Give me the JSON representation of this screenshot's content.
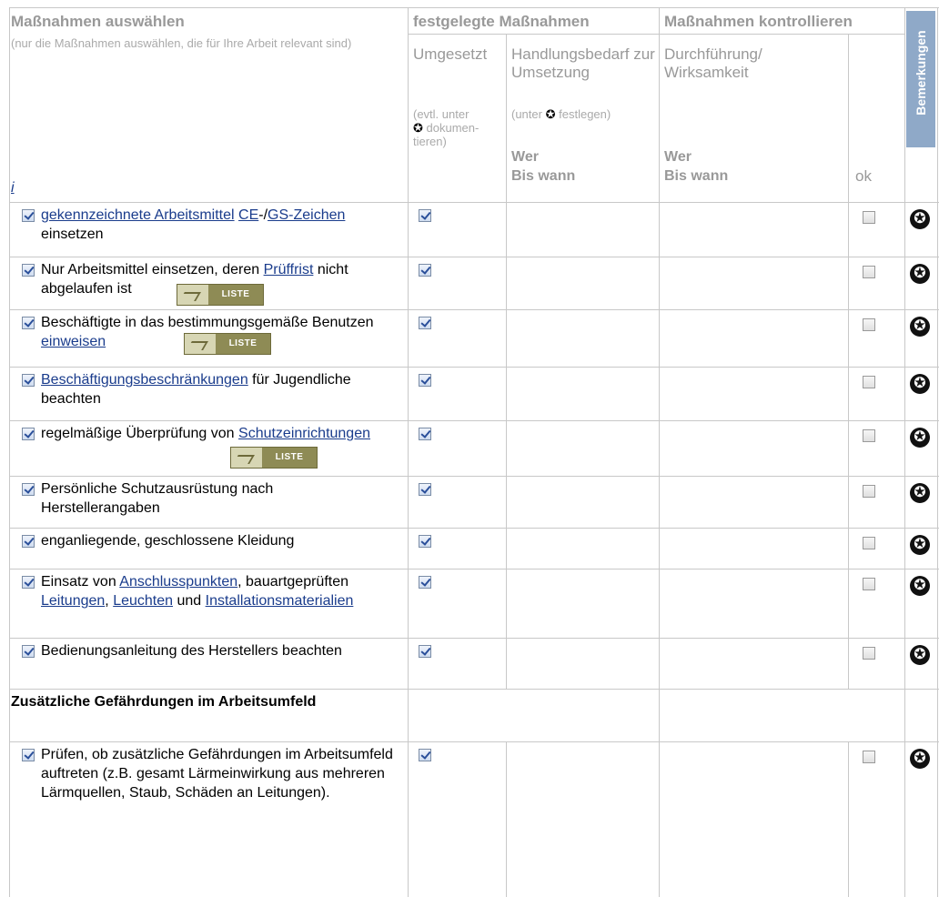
{
  "header": {
    "measures_title": "Maßnahmen auswählen",
    "measures_note": "(nur die Maßnahmen auswählen, die für Ihre Arbeit relevant sind)",
    "info_link": "i",
    "fixed_title": "festgelegte Maßnahmen",
    "implemented": "Umgesetzt",
    "implemented_note_1": "(evtl. unter",
    "implemented_note_2": "dokumen-",
    "implemented_note_3": "tieren)",
    "need": "Handlungsbedarf zur Umsetzung",
    "need_note_1": "(unter",
    "need_note_2": "festlegen)",
    "wer1": "Wer",
    "bis1": "Bis wann",
    "control_title": "Maßnahmen kontrollieren",
    "exec": "Durchführung/ Wirksamkeit",
    "wer2": "Wer",
    "bis2": "Bis wann",
    "ok": "ok",
    "remarks": "Bemerkungen"
  },
  "liste_label": "LISTE",
  "star_glyph": "✪",
  "rows": [
    {
      "parts": [
        {
          "t": "gekennzeichnete Arbeitsmittel",
          "link": true
        },
        {
          "t": " "
        },
        {
          "t": "CE",
          "link": true
        },
        {
          "t": "-/"
        },
        {
          "t": "GS-Zeichen",
          "link": true
        },
        {
          "t": " einsetzen"
        }
      ],
      "implemented": true,
      "ok": false
    },
    {
      "parts": [
        {
          "t": "Nur Arbeitsmittel einsetzen, deren "
        },
        {
          "t": "Prüffrist",
          "link": true
        },
        {
          "t": " nicht abgelaufen ist"
        }
      ],
      "implemented": true,
      "ok": false,
      "liste": true
    },
    {
      "parts": [
        {
          "t": "Beschäftigte in das bestimmungsgemäße Benutzen "
        },
        {
          "t": "einweisen",
          "link": true
        }
      ],
      "implemented": true,
      "ok": false,
      "liste": true
    },
    {
      "parts": [
        {
          "t": "Beschäftigungsbeschränkungen",
          "link": true
        },
        {
          "t": " für Jugendliche beachten"
        }
      ],
      "implemented": true,
      "ok": false
    },
    {
      "parts": [
        {
          "t": "regelmäßige Überprüfung von "
        },
        {
          "t": "Schutzeinrichtungen",
          "link": true
        }
      ],
      "implemented": true,
      "ok": false,
      "liste": true
    },
    {
      "parts": [
        {
          "t": "Persönliche Schutzausrüstung nach Herstellerangaben"
        }
      ],
      "implemented": true,
      "ok": false
    },
    {
      "parts": [
        {
          "t": "enganliegende, geschlossene Kleidung"
        }
      ],
      "implemented": true,
      "ok": false
    },
    {
      "parts": [
        {
          "t": "Einsatz von "
        },
        {
          "t": "Anschlusspunkten",
          "link": true
        },
        {
          "t": ", bauartgeprüften "
        },
        {
          "t": "Leitungen",
          "link": true
        },
        {
          "t": ", "
        },
        {
          "t": "Leuchten",
          "link": true
        },
        {
          "t": " und "
        },
        {
          "t": "Installationsmaterialien",
          "link": true
        }
      ],
      "implemented": true,
      "ok": false
    },
    {
      "parts": [
        {
          "t": "Bedienungsanleitung des Herstellers beachten"
        }
      ],
      "implemented": true,
      "ok": false
    },
    {
      "section": true,
      "text": "Zusätzliche Gefährdungen im Arbeitsumfeld"
    },
    {
      "parts": [
        {
          "t": "Prüfen, ob zusätzliche Gefährdungen im Arbeitsumfeld auftreten (z.B. gesamt Lärmeinwirkung aus mehreren Lärmquellen, Staub, Schäden an Leitungen)."
        }
      ],
      "implemented": true,
      "ok": false
    }
  ]
}
